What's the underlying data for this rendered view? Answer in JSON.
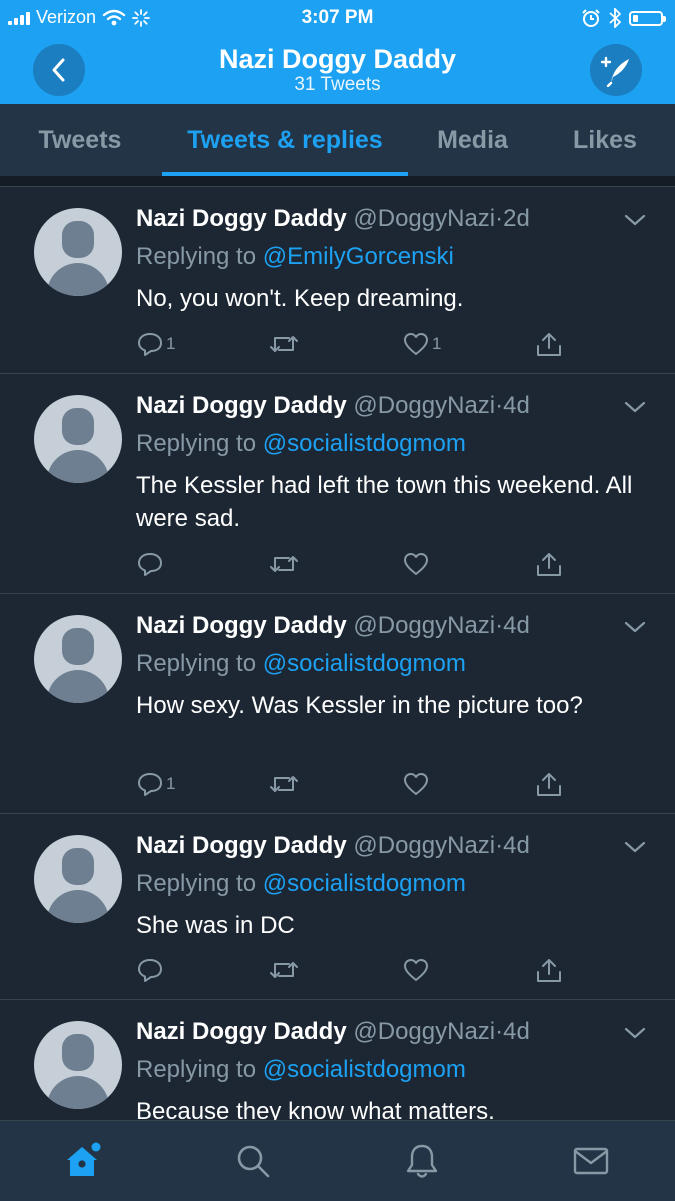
{
  "status_bar": {
    "carrier": "Verizon",
    "time": "3:07 PM",
    "battery_level": 0.2
  },
  "header": {
    "title": "Nazi Doggy Daddy",
    "subtitle": "31 Tweets"
  },
  "tabs": [
    {
      "label": "Tweets",
      "active": false
    },
    {
      "label": "Tweets & replies",
      "active": true
    },
    {
      "label": "Media",
      "active": false
    },
    {
      "label": "Likes",
      "active": false
    }
  ],
  "tweets": [
    {
      "name": "Nazi Doggy Daddy",
      "handle": "@DoggyNazi",
      "sep": "·",
      "time": "2d",
      "reply_prefix": "Replying to",
      "reply_to": "@EmilyGorcenski",
      "text": "No, you won't.  Keep dreaming.",
      "replies": "1",
      "retweets": "",
      "likes": "1"
    },
    {
      "name": "Nazi Doggy Daddy",
      "handle": "@DoggyNazi",
      "sep": "·",
      "time": "4d",
      "reply_prefix": "Replying to",
      "reply_to": "@socialistdogmom",
      "text": "The Kessler had left the town this weekend.  All were sad.",
      "replies": "",
      "retweets": "",
      "likes": ""
    },
    {
      "name": "Nazi Doggy Daddy",
      "handle": "@DoggyNazi",
      "sep": "·",
      "time": "4d",
      "reply_prefix": "Replying to",
      "reply_to": "@socialistdogmom",
      "text": "How sexy.  Was Kessler in the picture too?",
      "replies": "1",
      "retweets": "",
      "likes": ""
    },
    {
      "name": "Nazi Doggy Daddy",
      "handle": "@DoggyNazi",
      "sep": "·",
      "time": "4d",
      "reply_prefix": "Replying to",
      "reply_to": "@socialistdogmom",
      "text": "She was in DC",
      "replies": "",
      "retweets": "",
      "likes": ""
    },
    {
      "name": "Nazi Doggy Daddy",
      "handle": "@DoggyNazi",
      "sep": "·",
      "time": "4d",
      "reply_prefix": "Replying to",
      "reply_to": "@socialistdogmom",
      "text": "Because they know what matters.",
      "replies": "",
      "retweets": "",
      "likes": ""
    }
  ],
  "bottom_nav": [
    {
      "icon": "home-icon",
      "active": true
    },
    {
      "icon": "search-icon",
      "active": false
    },
    {
      "icon": "bell-icon",
      "active": false
    },
    {
      "icon": "mail-icon",
      "active": false
    }
  ],
  "colors": {
    "brand": "#1da1f2",
    "background": "#1c2733",
    "muted": "#8899a6"
  }
}
